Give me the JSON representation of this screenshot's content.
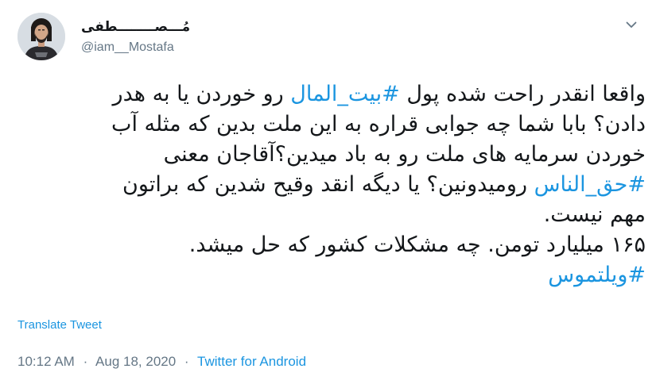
{
  "user": {
    "display_name": "مُـــصــــــــطفی",
    "handle": "@iam__Mostafa"
  },
  "icons": {
    "menu": "chevron-down-icon",
    "avatar": "user-photo"
  },
  "tweet": {
    "lines": [
      [
        {
          "text": "واقعا انقدر راحت شده پول ",
          "type": "text"
        },
        {
          "text": "#بیت_المال",
          "type": "hashtag"
        },
        {
          "text": " رو خوردن یا به هدر",
          "type": "text"
        }
      ],
      [
        {
          "text": "دادن؟ بابا شما چه جوابی قراره به این ملت بدین که مثله آب",
          "type": "text"
        }
      ],
      [
        {
          "text": "خوردن سرمایه های ملت رو به باد میدین؟آقاجان معنی",
          "type": "text"
        }
      ],
      [
        {
          "text": "#حق_الناس",
          "type": "hashtag"
        },
        {
          "text": " رومیدونین؟ یا دیگه انقد وقیح شدین که براتون",
          "type": "text"
        }
      ],
      [
        {
          "text": "مهم نیست.",
          "type": "text"
        }
      ],
      [
        {
          "text": "۱۶۵ میلیارد تومن. چه مشکلات کشور که حل میشد.",
          "type": "text"
        }
      ],
      [
        {
          "text": "#ویلتموس",
          "type": "hashtag"
        }
      ]
    ]
  },
  "translate_label": "Translate Tweet",
  "meta": {
    "time": "10:12 AM",
    "separator": "·",
    "date": "Aug 18, 2020",
    "source": "Twitter for Android"
  },
  "colors": {
    "link": "#1b95e0",
    "secondary_text": "#657786",
    "primary_text": "#14171a"
  }
}
